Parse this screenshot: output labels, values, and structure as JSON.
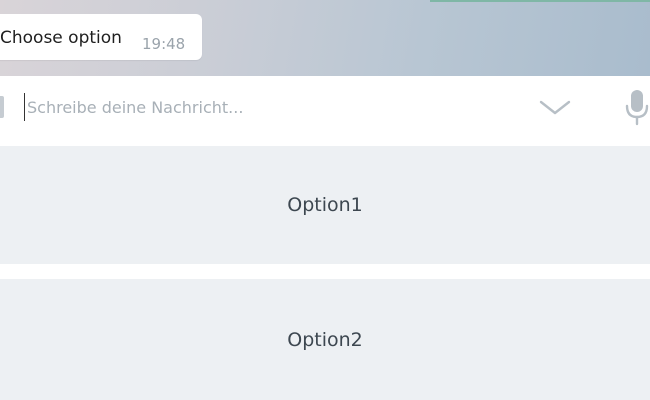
{
  "chat": {
    "message": {
      "text": "Choose option",
      "time": "19:48"
    }
  },
  "composer": {
    "placeholder": "Schreibe deine Nachricht...",
    "icons": [
      "paperclip-icon",
      "chevron-down-icon",
      "microphone-icon"
    ]
  },
  "keyboard": {
    "options": [
      {
        "label": "Option1"
      },
      {
        "label": "Option2"
      }
    ]
  },
  "colors": {
    "button_bg": "#edf0f3",
    "button_text": "#3d4750",
    "placeholder": "#a8b0b7"
  }
}
